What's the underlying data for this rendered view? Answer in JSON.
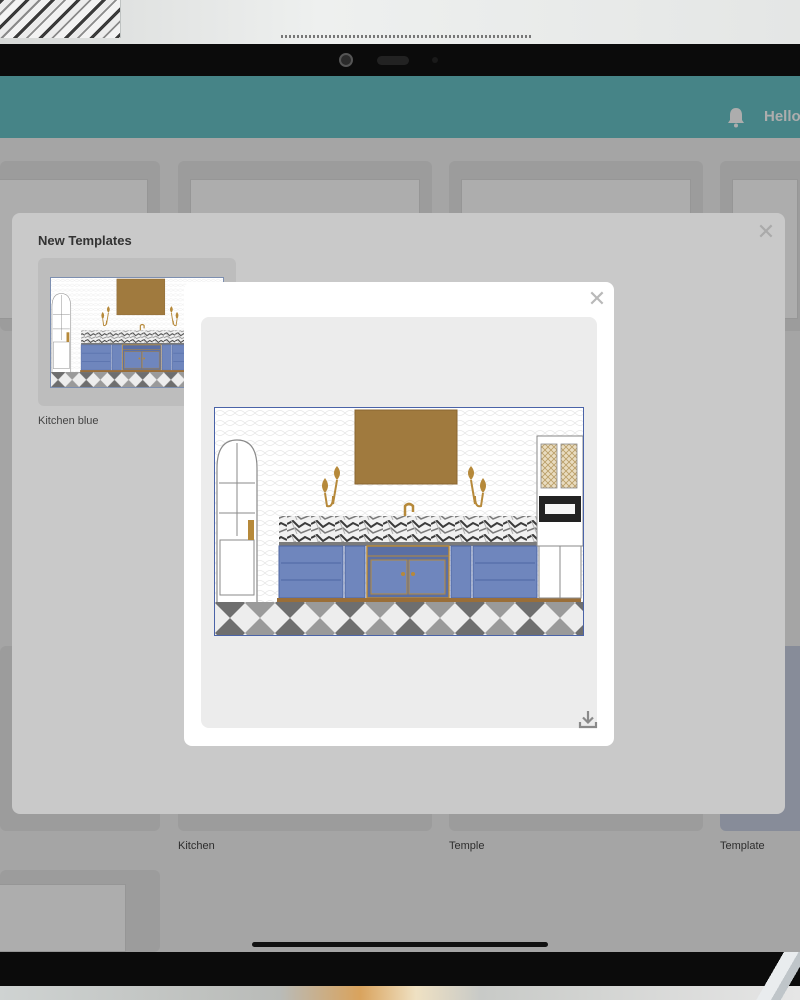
{
  "header": {
    "greeting": "Hello"
  },
  "grid": {
    "card_labels": [
      "Kitchen",
      "Temple",
      "Template"
    ]
  },
  "panel": {
    "title": "New Templates",
    "template_name": "Kitchen blue"
  },
  "modal": {
    "close_symbol": "✕",
    "download_icon": "download-icon"
  },
  "colors": {
    "header": "#68c3c7",
    "cabinet_blue": "#6f86bd",
    "brass": "#b6893a",
    "hood_bronze": "#a07a3e"
  }
}
